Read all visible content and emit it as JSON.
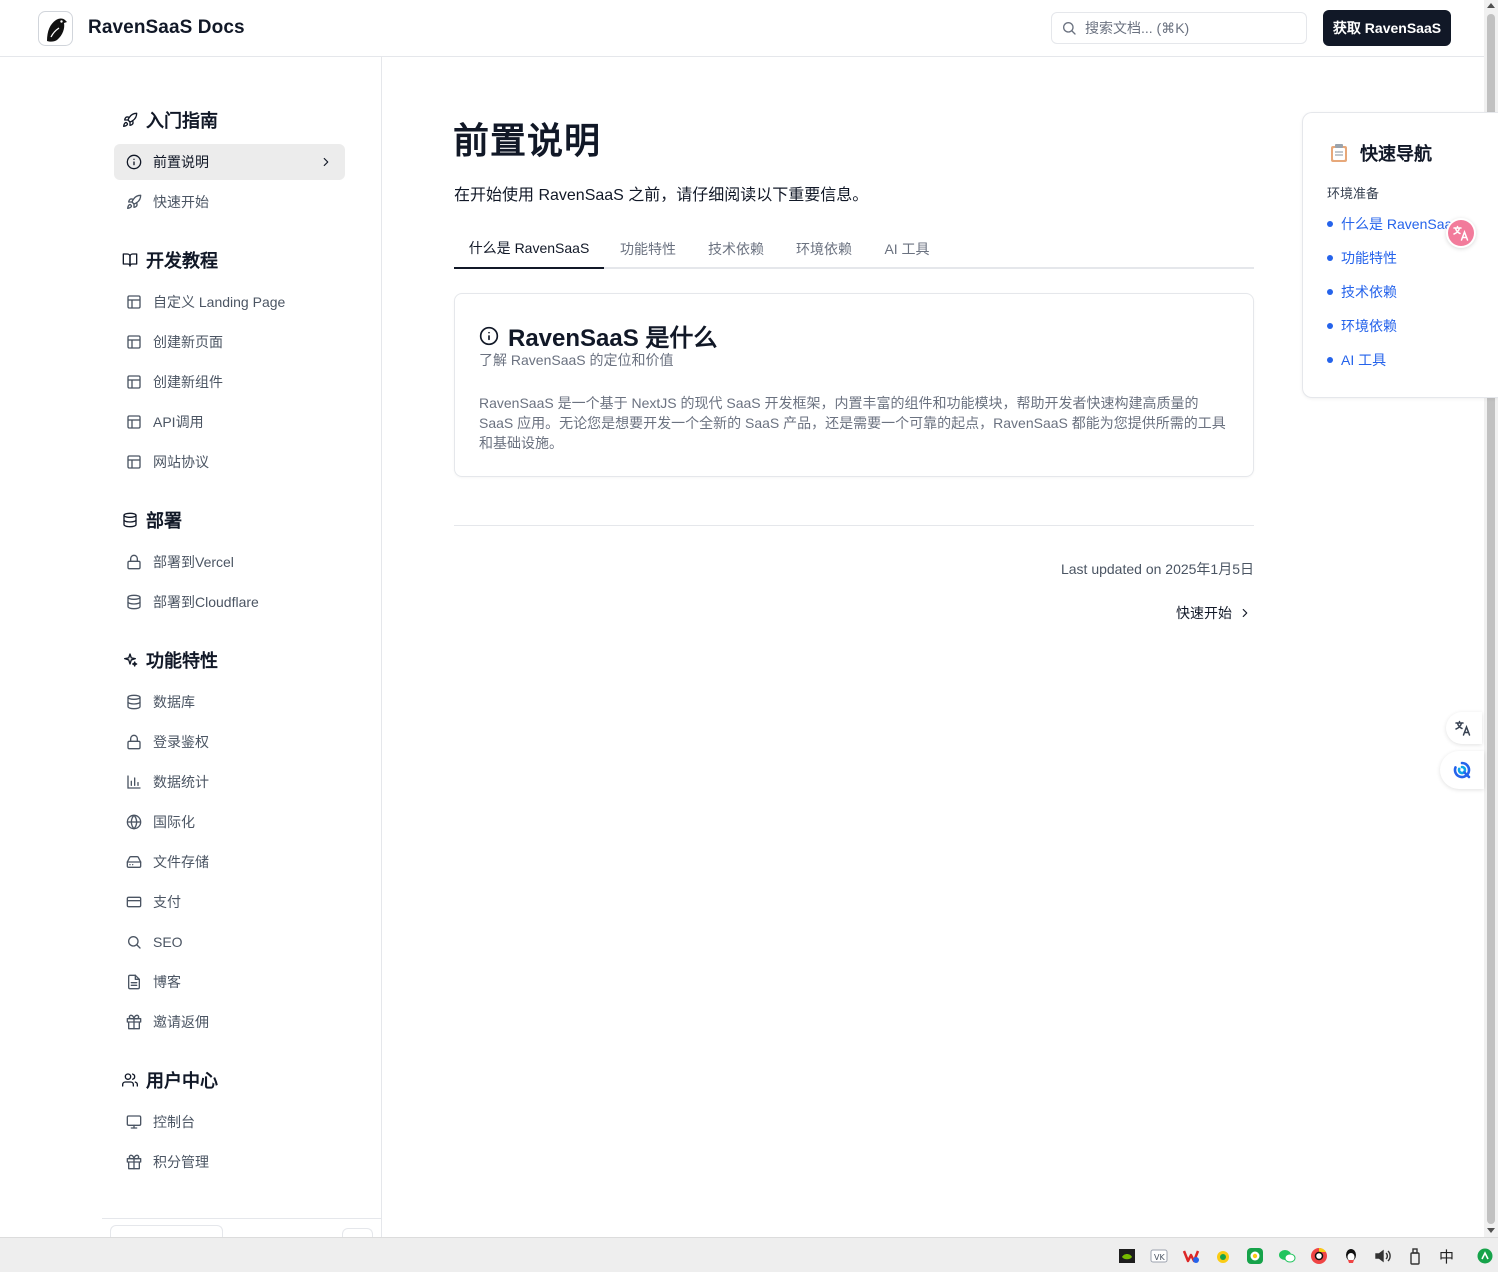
{
  "header": {
    "brand": "RavenSaaS Docs",
    "search_placeholder": "搜索文档... (⌘K)",
    "cta_label": "获取 RavenSaaS"
  },
  "sidebar": {
    "sections": [
      {
        "title": "入门指南",
        "icon": "rocket-icon",
        "items": [
          {
            "label": "前置说明",
            "icon": "info-icon",
            "active": true
          },
          {
            "label": "快速开始",
            "icon": "rocket-icon"
          }
        ]
      },
      {
        "title": "开发教程",
        "icon": "book-open-icon",
        "items": [
          {
            "label": "自定义 Landing Page",
            "icon": "layout-icon"
          },
          {
            "label": "创建新页面",
            "icon": "layout-icon"
          },
          {
            "label": "创建新组件",
            "icon": "layout-icon"
          },
          {
            "label": "API调用",
            "icon": "layout-icon"
          },
          {
            "label": "网站协议",
            "icon": "layout-icon"
          }
        ]
      },
      {
        "title": "部署",
        "icon": "database-icon",
        "items": [
          {
            "label": "部署到Vercel",
            "icon": "lock-icon"
          },
          {
            "label": "部署到Cloudflare",
            "icon": "database-icon"
          }
        ]
      },
      {
        "title": "功能特性",
        "icon": "sparkles-icon",
        "items": [
          {
            "label": "数据库",
            "icon": "database-icon"
          },
          {
            "label": "登录鉴权",
            "icon": "lock-icon"
          },
          {
            "label": "数据统计",
            "icon": "bar-chart-icon"
          },
          {
            "label": "国际化",
            "icon": "globe-icon"
          },
          {
            "label": "文件存储",
            "icon": "hard-drive-icon"
          },
          {
            "label": "支付",
            "icon": "credit-card-icon"
          },
          {
            "label": "SEO",
            "icon": "search-icon"
          },
          {
            "label": "博客",
            "icon": "file-text-icon"
          },
          {
            "label": "邀请返佣",
            "icon": "gift-icon"
          }
        ]
      },
      {
        "title": "用户中心",
        "icon": "users-icon",
        "items": [
          {
            "label": "控制台",
            "icon": "monitor-icon"
          },
          {
            "label": "积分管理",
            "icon": "gift-icon"
          }
        ]
      }
    ]
  },
  "main": {
    "title": "前置说明",
    "description": "在开始使用 RavenSaaS 之前，请仔细阅读以下重要信息。",
    "tabs": [
      {
        "label": "什么是 RavenSaaS",
        "active": true
      },
      {
        "label": "功能特性"
      },
      {
        "label": "技术依赖"
      },
      {
        "label": "环境依赖"
      },
      {
        "label": "AI 工具"
      }
    ],
    "card": {
      "title": "RavenSaaS 是什么",
      "subtitle": "了解 RavenSaaS 的定位和价值",
      "body": "RavenSaaS 是一个基于 NextJS 的现代 SaaS 开发框架，内置丰富的组件和功能模块，帮助开发者快速构建高质量的 SaaS 应用。无论您是想要开发一个全新的 SaaS 产品，还是需要一个可靠的起点，RavenSaaS 都能为您提供所需的工具和基础设施。"
    },
    "last_updated": "Last updated on 2025年1月5日",
    "next_link": "快速开始"
  },
  "toc": {
    "title": "快速导航",
    "subtitle": "环境准备",
    "items": [
      "什么是 RavenSaaS",
      "功能特性",
      "技术依赖",
      "环境依赖",
      "AI 工具"
    ]
  },
  "taskbar": {
    "ime_label": "中"
  },
  "colors": {
    "accent": "#111827",
    "link": "#2563eb",
    "muted": "#6b7280",
    "border": "#e5e7eb",
    "active_bg": "#ececec"
  }
}
